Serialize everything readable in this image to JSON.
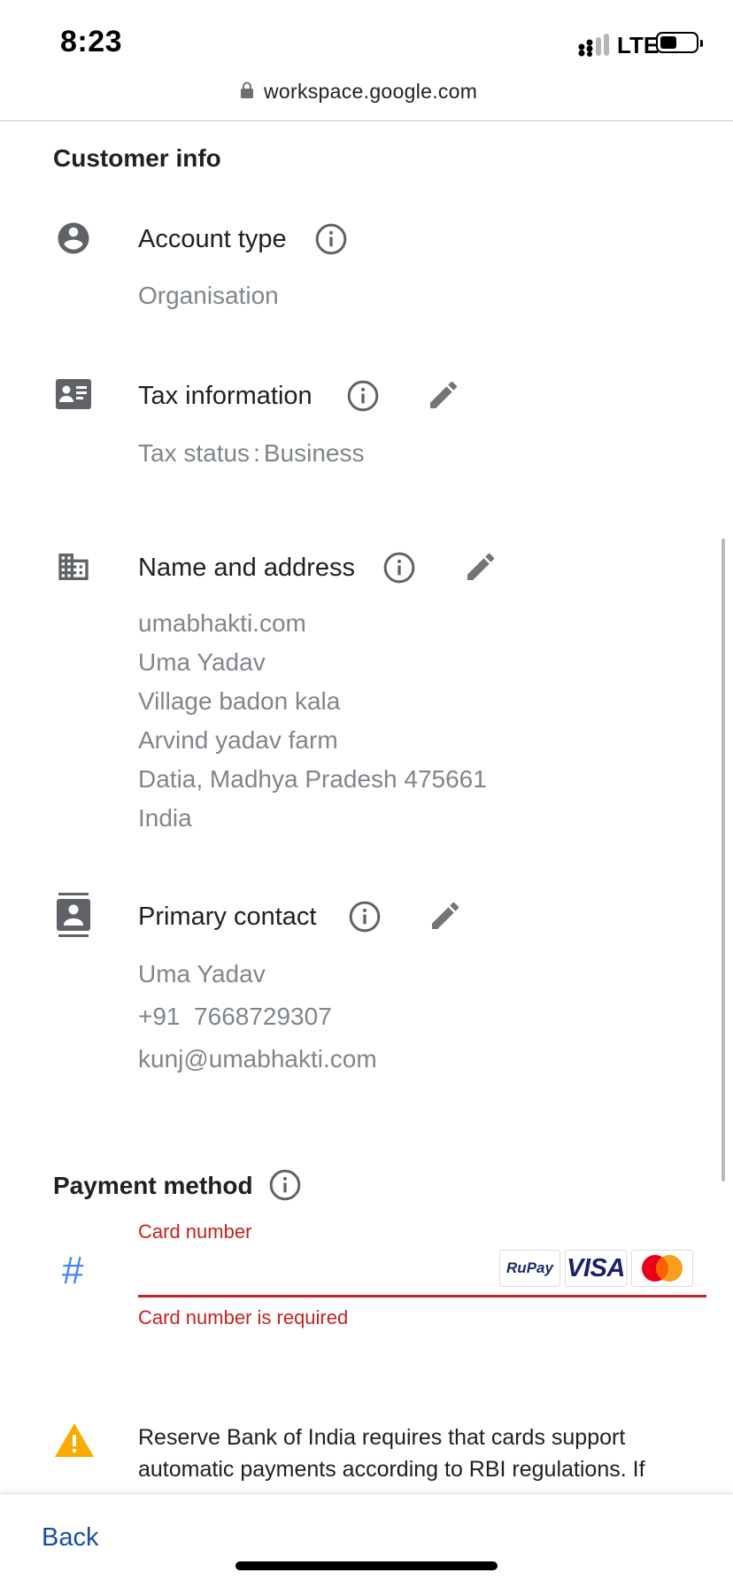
{
  "status_bar": {
    "time": "8:23",
    "network": "LTE"
  },
  "browser": {
    "url": "workspace.google.com"
  },
  "customer_info": {
    "title": "Customer info",
    "account_type": {
      "label": "Account type",
      "value": "Organisation"
    },
    "tax_information": {
      "label": "Tax information",
      "status_label": "Tax status",
      "status_value": "Business"
    },
    "name_and_address": {
      "label": "Name and address",
      "lines": [
        "umabhakti.com",
        "Uma Yadav",
        "Village badon kala",
        "Arvind yadav farm",
        "Datia, Madhya Pradesh 475661",
        "India"
      ]
    },
    "primary_contact": {
      "label": "Primary contact",
      "name": "Uma Yadav",
      "phone": "+91  7668729307",
      "email": "kunj@umabhakti.com"
    }
  },
  "payment_method": {
    "title": "Payment method",
    "card_number_label": "Card number",
    "card_number_value": "",
    "card_number_error": "Card number is required",
    "card_logos": [
      "RuPay",
      "VISA",
      "mastercard"
    ]
  },
  "warning": {
    "text": "Reserve Bank of India requires that cards support automatic payments according to RBI regulations. If"
  },
  "footer": {
    "back_label": "Back"
  },
  "colors": {
    "error": "#c5221f",
    "link": "#174ea6",
    "icon": "#5f6368",
    "accent": "#4285f4",
    "warning": "#f9ab00"
  }
}
